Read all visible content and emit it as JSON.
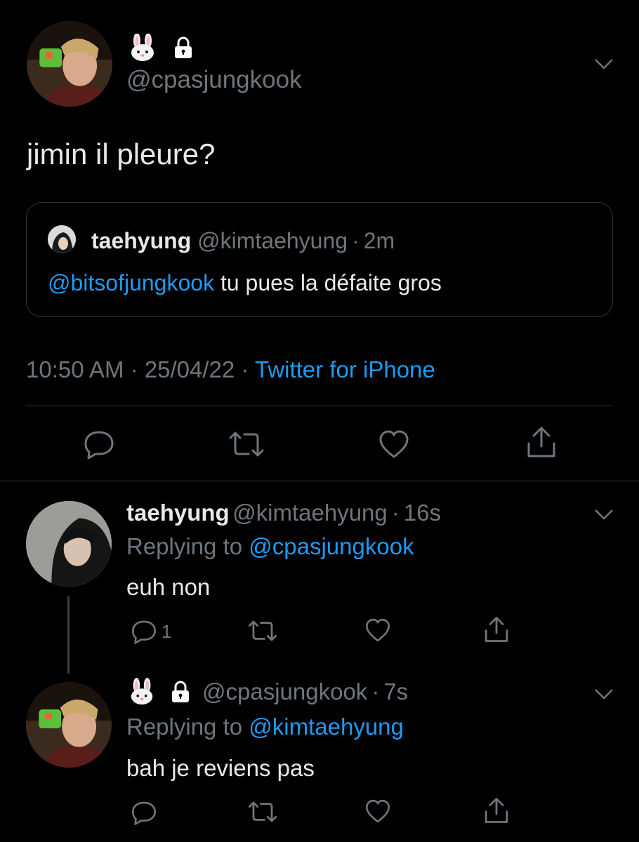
{
  "main_tweet": {
    "handle": "@cpasjungkook",
    "text": "jimin il pleure?",
    "icons": [
      "rabbit-face-emoji",
      "lock-icon"
    ],
    "quoted": {
      "name": "taehyung",
      "handle": "@kimtaehyung",
      "dot": "·",
      "time": "2m",
      "mention": "@bitsofjungkook",
      "text": " tu pues la défaite gros"
    },
    "meta": {
      "time": "10:50 AM",
      "sep1": " · ",
      "date": "25/04/22",
      "sep2": " · ",
      "source": "Twitter for iPhone"
    }
  },
  "replies": [
    {
      "name": "taehyung",
      "handle": "@kimtaehyung",
      "dot": "·",
      "time": "16s",
      "replying_prefix": "Replying to ",
      "replying_to": "@cpasjungkook",
      "text": "euh non",
      "reply_count": "1"
    },
    {
      "handle": "@cpasjungkook",
      "dot": "·",
      "time": "7s",
      "replying_prefix": "Replying to ",
      "replying_to": "@kimtaehyung",
      "text": "bah je reviens pas"
    }
  ],
  "colors": {
    "background": "#000000",
    "text": "#e7e9ea",
    "muted": "#6e767d",
    "link": "#1d9bf0",
    "border": "#2f3336"
  }
}
